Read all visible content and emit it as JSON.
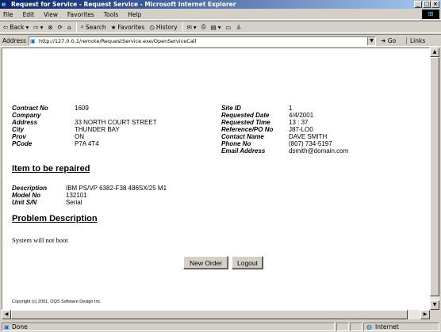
{
  "window": {
    "title": "Request for Service - Request Service - Microsoft Internet Explorer"
  },
  "menu": [
    "File",
    "Edit",
    "View",
    "Favorites",
    "Tools",
    "Help"
  ],
  "toolbar": {
    "back": "Back",
    "search": "Search",
    "favorites": "Favorites",
    "history": "History"
  },
  "address": {
    "label": "Address",
    "url": "http://127.0.0.1/remote/RequestService.exe/OpenServiceCall",
    "go": "Go",
    "links": "Links"
  },
  "left_fields": [
    {
      "label": "Contract No",
      "value": "1609"
    },
    {
      "label": "Company",
      "value": ""
    },
    {
      "label": "Address",
      "value": "33 NORTH COURT STREET"
    },
    {
      "label": "City",
      "value": "THUNDER BAY"
    },
    {
      "label": "Prov",
      "value": "ON"
    },
    {
      "label": "PCode",
      "value": "P7A 4T4"
    }
  ],
  "right_fields": [
    {
      "label": "Site ID",
      "value": "1"
    },
    {
      "label": "Requested Date",
      "value": "4/4/2001"
    },
    {
      "label": "Requested Time",
      "value": "13 : 37"
    },
    {
      "label": "Reference/PO No",
      "value": "J87-LO0"
    },
    {
      "label": "Contact Name",
      "value": "DAVE SMITH"
    },
    {
      "label": "Phone No",
      "value": "(807) 734-5197"
    },
    {
      "label": "Email Address",
      "value": "dsmith@domain.com"
    }
  ],
  "item_section": {
    "heading": "Item to be repaired",
    "fields": [
      {
        "label": "Description",
        "value": "IBM PS/VP 6382-F38 486SX/25 M1"
      },
      {
        "label": "Model No",
        "value": "132101"
      },
      {
        "label": "Unit S/N",
        "value": "Serial"
      }
    ]
  },
  "problem_section": {
    "heading": "Problem Description",
    "text": "System will not boot"
  },
  "buttons": {
    "new_order": "New Order",
    "logout": "Logout"
  },
  "footer": {
    "copyright": "Copyright (c) 2001, OQS Software Design Inc."
  },
  "status": {
    "text": "Done",
    "zone": "Internet"
  }
}
